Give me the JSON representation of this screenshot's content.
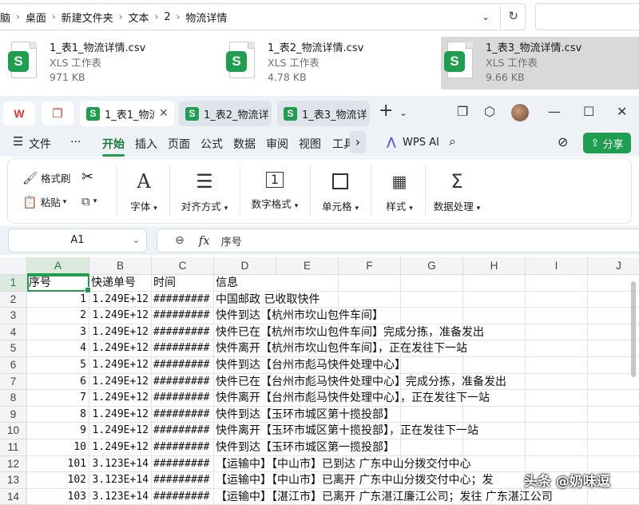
{
  "explorer": {
    "breadcrumbs": [
      "脑",
      "桌面",
      "新建文件夹",
      "文本",
      "2",
      "物流详情"
    ],
    "files": [
      {
        "name": "1_表1_物流详情.csv",
        "type": "XLS 工作表",
        "size": "971 KB",
        "selected": false
      },
      {
        "name": "1_表2_物流详情.csv",
        "type": "XLS 工作表",
        "size": "4.78 KB",
        "selected": false
      },
      {
        "name": "1_表3_物流详情.csv",
        "type": "XLS 工作表",
        "size": "9.66 KB",
        "selected": true
      }
    ]
  },
  "tabs": [
    {
      "label": "1_表1_物流",
      "active": true
    },
    {
      "label": "1_表2_物流详",
      "active": false
    },
    {
      "label": "1_表3_物流详",
      "active": false
    }
  ],
  "menu": {
    "file": "文件",
    "more": "···",
    "items": [
      "开始",
      "插入",
      "页面",
      "公式",
      "数据",
      "审阅",
      "视图",
      "工具"
    ],
    "active": "开始",
    "wps_ai": "WPS AI",
    "share": "分享"
  },
  "ribbon": {
    "format_painter": "格式刷",
    "paste": "粘贴",
    "font": "字体",
    "alignment": "对齐方式",
    "number_format": "数字格式",
    "cells": "单元格",
    "styles": "样式",
    "data_processing": "数据处理"
  },
  "formula_bar": {
    "cell_ref": "A1",
    "fx": "fx",
    "value": "序号"
  },
  "grid": {
    "columns": [
      "A",
      "B",
      "C",
      "D",
      "E",
      "F",
      "G",
      "H",
      "I",
      "J"
    ],
    "rows": [
      {
        "n": "1",
        "a": "序号",
        "b": "快递单号",
        "c": "时间",
        "d": "信息"
      },
      {
        "n": "2",
        "a": "1",
        "b": "1.249E+12",
        "c": "#########",
        "d": "中国邮政 已收取快件"
      },
      {
        "n": "3",
        "a": "2",
        "b": "1.249E+12",
        "c": "#########",
        "d": "快件到达【杭州市坎山包件车间】"
      },
      {
        "n": "4",
        "a": "3",
        "b": "1.249E+12",
        "c": "#########",
        "d": "快件已在【杭州市坎山包件车间】完成分拣，准备发出"
      },
      {
        "n": "5",
        "a": "4",
        "b": "1.249E+12",
        "c": "#########",
        "d": "快件离开【杭州市坎山包件车间】，正在发往下一站"
      },
      {
        "n": "6",
        "a": "5",
        "b": "1.249E+12",
        "c": "#########",
        "d": "快件到达【台州市彪马快件处理中心】"
      },
      {
        "n": "7",
        "a": "6",
        "b": "1.249E+12",
        "c": "#########",
        "d": "快件已在【台州市彪马快件处理中心】完成分拣，准备发出"
      },
      {
        "n": "8",
        "a": "7",
        "b": "1.249E+12",
        "c": "#########",
        "d": "快件离开【台州市彪马快件处理中心】，正在发往下一站"
      },
      {
        "n": "9",
        "a": "8",
        "b": "1.249E+12",
        "c": "#########",
        "d": "快件到达【玉环市城区第十揽投部】"
      },
      {
        "n": "10",
        "a": "9",
        "b": "1.249E+12",
        "c": "#########",
        "d": "快件离开【玉环市城区第十揽投部】，正在发往下一站"
      },
      {
        "n": "11",
        "a": "10",
        "b": "1.249E+12",
        "c": "#########",
        "d": "快件到达【玉环市城区第一揽投部】"
      },
      {
        "n": "12",
        "a": "101",
        "b": "3.123E+14",
        "c": "#########",
        "d": "【运输中】【中山市】已到达 广东中山分拨交付中心"
      },
      {
        "n": "13",
        "a": "102",
        "b": "3.123E+14",
        "c": "#########",
        "d": "【运输中】【中山市】已离开 广东中山分拨交付中心；发"
      },
      {
        "n": "14",
        "a": "103",
        "b": "3.123E+14",
        "c": "#########",
        "d": "【运输中】【湛江市】已离开 广东湛江廉江公司；发往 广东湛江公司"
      }
    ]
  },
  "watermark": "头条 @奶味逗"
}
